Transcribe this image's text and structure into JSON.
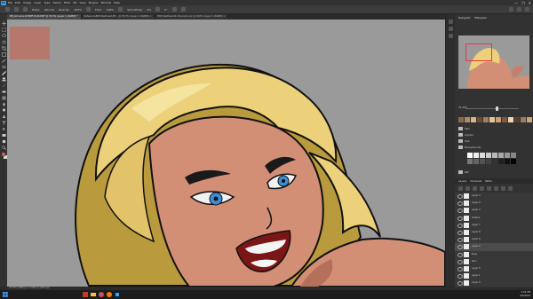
{
  "menubar": {
    "logo": "Ps",
    "items": [
      "File",
      "Edit",
      "Image",
      "Layer",
      "Type",
      "Select",
      "Filter",
      "3D",
      "View",
      "Plugins",
      "Window",
      "Help"
    ],
    "window_controls": [
      "—",
      "❐",
      "✕"
    ]
  },
  "options": {
    "mode_label": "Mode:",
    "mode_value": "Normal",
    "opacity_label": "Opacity:",
    "opacity_value": "100%",
    "flow_label": "Flow:",
    "flow_value": "100%",
    "smoothing_label": "Smoothing:",
    "smoothing_value": "0%",
    "angle_value": "0°"
  },
  "tabs": [
    {
      "label": "PB_Girl-Lara-R-T0MF-Hi-ShiH4F @ 33.3% (Layer 1, RGB/8) *",
      "active": true
    },
    {
      "label": "ReferenceBOH-Redhead-EH... @ 33.3% (Layer 2, RGB/8) ×",
      "active": false
    },
    {
      "label": "BOH-Redhead-R-30-render-ink @ 100% (Layer 0, RGB/8) ×",
      "active": false
    }
  ],
  "navigator": {
    "tabs": [
      "Navigator",
      "Histogram"
    ],
    "zoom": "33.33%"
  },
  "swatch_colors": [
    "#8a6a4c",
    "#b08a63",
    "#d9b38a",
    "#6b4b3a",
    "#a27e5a",
    "#e3c49d",
    "#c99f74",
    "#7a5a44",
    "#eed6b3",
    "#5b4030",
    "#9c7b5e",
    "#caa27c",
    "#f1dfc4",
    "#3f3f3f",
    "#262626"
  ],
  "folders": [
    "Skin",
    "Lighter",
    "Hair",
    "Backgrounds",
    "Ref"
  ],
  "gray_colors": [
    "#ffffff",
    "#ededed",
    "#dcdcdc",
    "#cbcbcb",
    "#bababa",
    "#a9a9a9",
    "#989898",
    "#878787",
    "#767676",
    "#656565",
    "#545454",
    "#434343",
    "#323232",
    "#212121",
    "#101010",
    "#000000"
  ],
  "layers_panel": {
    "tabs": [
      "Layers",
      "Channels",
      "Paths"
    ],
    "items": [
      {
        "name": "Layer 3",
        "selected": false
      },
      {
        "name": "Layer 9",
        "selected": false
      },
      {
        "name": "Layer 4",
        "selected": false
      },
      {
        "name": "Outline",
        "selected": false
      },
      {
        "name": "Layer 7",
        "selected": false
      },
      {
        "name": "Layer 8",
        "selected": false
      },
      {
        "name": "Layer 6",
        "selected": false
      },
      {
        "name": "Layer 2",
        "selected": true
      },
      {
        "name": "Eyes",
        "selected": false
      },
      {
        "name": "Skin",
        "selected": false
      },
      {
        "name": "Layer 5",
        "selected": false
      },
      {
        "name": "Layer 1",
        "selected": false
      },
      {
        "name": "Layer 0",
        "selected": false
      }
    ]
  },
  "status": {
    "text": "33.33%    2480 px x 1748 px (300 ppi)"
  },
  "taskbar": {
    "time": "4:52 PM",
    "date": "9/5/2023"
  }
}
